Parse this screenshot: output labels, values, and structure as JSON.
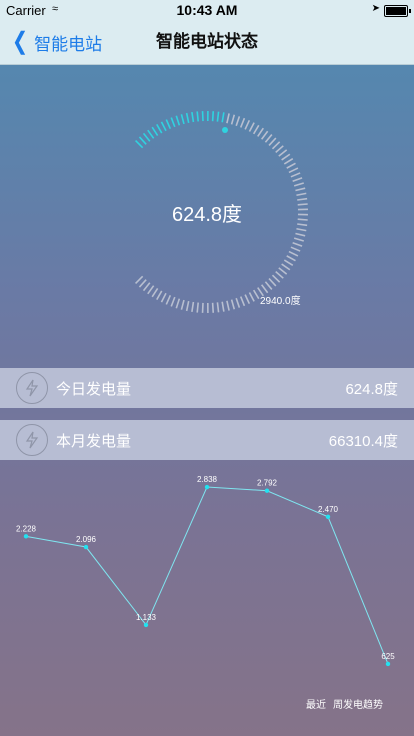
{
  "status_bar": {
    "carrier": "Carrier",
    "time": "10:43 AM"
  },
  "nav": {
    "back_label": "智能电站",
    "title": "智能电站状态"
  },
  "gauge": {
    "value_text": "624.8度",
    "max_text": "2940.0度",
    "fill_fraction": 0.2125,
    "active_color": "#2fd3e0",
    "track_color": "#b8bfd0"
  },
  "stats": [
    {
      "label": "今日发电量",
      "value": "624.8度"
    },
    {
      "label": "本月发电量",
      "value": "66310.4度"
    }
  ],
  "chart_caption": {
    "left": "最近",
    "right": "周发电趋势"
  },
  "chart_data": {
    "type": "line",
    "series": [
      {
        "values": [
          2.228,
          2.096,
          1.133,
          2.838,
          2.792,
          2.47,
          0.65
        ]
      }
    ],
    "labels": [
      "2.228",
      "2.096",
      "1.133",
      "2.838",
      "2.792",
      "2.470",
      "625"
    ],
    "line_color": "#7fe6f0",
    "point_color": "#22e2f0"
  }
}
